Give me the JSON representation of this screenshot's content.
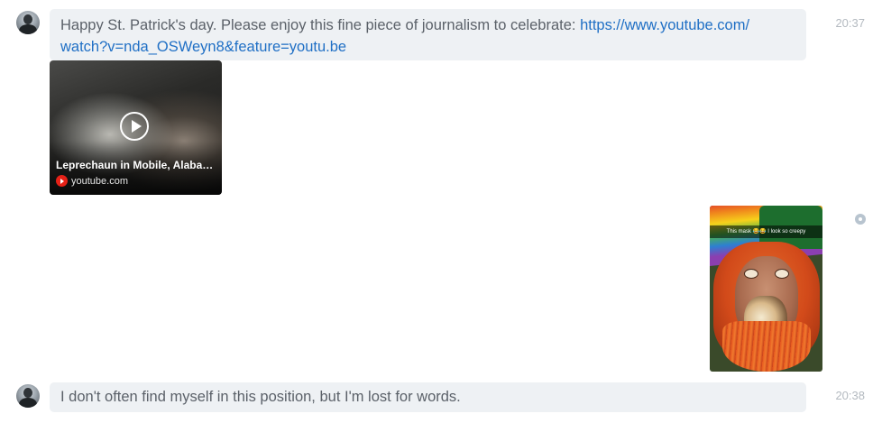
{
  "messages": [
    {
      "text": "Happy St. Patrick's day. Please enjoy this fine piece of journalism to celebrate: ",
      "link_part1": "https://www.youtube.com/",
      "link_part2": "watch?v=nda_OSWeyn8&feature=youtu.be",
      "time": "20:37",
      "card": {
        "title": "Leprechaun in Mobile, Alaba…",
        "source": "youtube.com",
        "icon": "youtube-icon",
        "play_icon": "play-icon"
      }
    },
    {
      "image_caption": "This mask 😂😂 I look so creepy",
      "status_icon": "read-receipt-icon"
    },
    {
      "text": "I don't often find myself in this position, but I'm lost for words.",
      "time": "20:38"
    }
  ],
  "colors": {
    "bubble_bg": "#eef1f4",
    "text": "#5b6169",
    "link": "#1f6fc5",
    "time": "#b4bac0"
  }
}
